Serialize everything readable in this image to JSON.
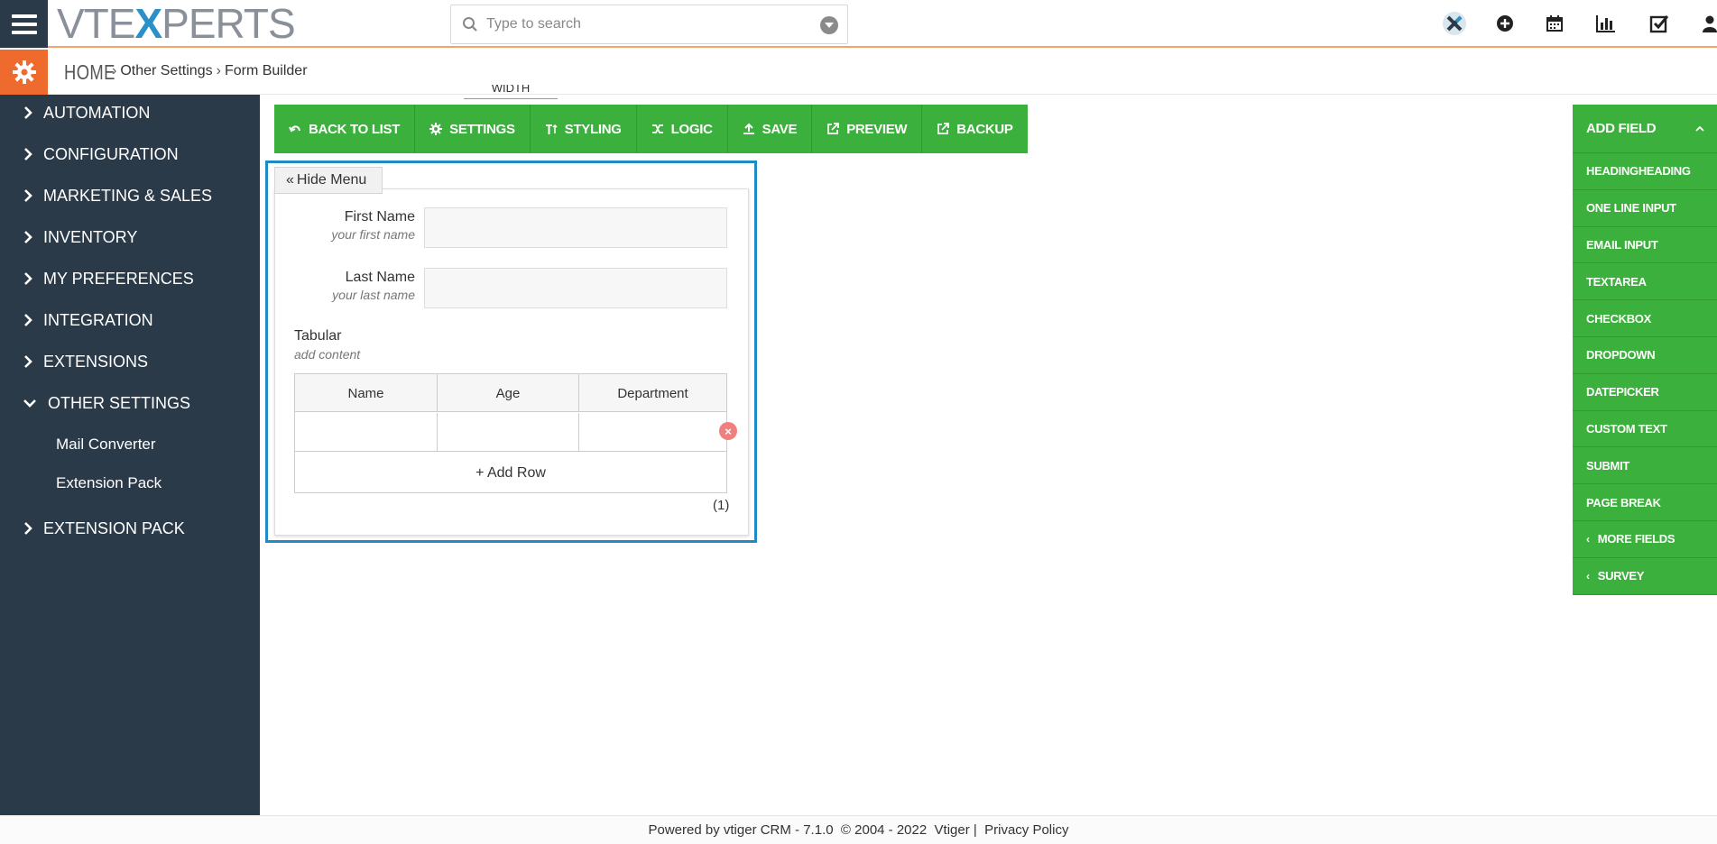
{
  "header": {
    "logo_text_left": "VTE",
    "logo_text_x": "X",
    "logo_text_right": "PERTS",
    "search_placeholder": "Type to search",
    "icons": [
      "vtexperts-x-icon",
      "plus-circle-icon",
      "calendar-icon",
      "bar-chart-icon",
      "checkbox-icon",
      "user-icon"
    ]
  },
  "breadcrumb": {
    "home": "HOME",
    "items": [
      "Other Settings",
      "Form Builder"
    ]
  },
  "sidebar": {
    "items": [
      {
        "label": "AUTOMATION",
        "expanded": false
      },
      {
        "label": "CONFIGURATION",
        "expanded": false
      },
      {
        "label": "MARKETING & SALES",
        "expanded": false
      },
      {
        "label": "INVENTORY",
        "expanded": false
      },
      {
        "label": "MY PREFERENCES",
        "expanded": false
      },
      {
        "label": "INTEGRATION",
        "expanded": false
      },
      {
        "label": "EXTENSIONS",
        "expanded": false
      },
      {
        "label": "OTHER SETTINGS",
        "expanded": true
      },
      {
        "label": "EXTENSION PACK",
        "expanded": false
      }
    ],
    "subitems": [
      "Mail Converter",
      "Extension Pack"
    ]
  },
  "toolbar": {
    "width_label": "WIDTH",
    "buttons": [
      "BACK TO LIST",
      "SETTINGS",
      "STYLING",
      "LOGIC",
      "SAVE",
      "PREVIEW",
      "BACKUP"
    ]
  },
  "form": {
    "hide_menu": "Hide Menu",
    "fields": [
      {
        "label": "First Name",
        "hint": "your first name",
        "value": ""
      },
      {
        "label": "Last Name",
        "hint": "your last name",
        "value": ""
      }
    ],
    "tabular": {
      "title": "Tabular",
      "hint": "add content",
      "columns": [
        "Name",
        "Age",
        "Department"
      ],
      "add_row": "+ Add Row",
      "count": "(1)"
    }
  },
  "right_panel": {
    "head": "ADD FIELD",
    "items": [
      "HEADINGHEADING",
      "ONE LINE INPUT",
      "EMAIL INPUT",
      "TEXTAREA",
      "CHECKBOX",
      "DROPDOWN",
      "DATEPICKER",
      "CUSTOM TEXT",
      "SUBMIT",
      "PAGE BREAK"
    ],
    "more_fields": "MORE FIELDS",
    "survey": "SURVEY"
  },
  "footer": {
    "text": "Powered by vtiger CRM - 7.1.0  © 2004 - 2022  Vtiger |  Privacy Policy"
  },
  "colors": {
    "sidebar_bg": "#2b3a48",
    "accent_orange": "#ef6b2d",
    "toolbar_green": "#3cb03c",
    "frame_blue": "#1e8ac6"
  }
}
